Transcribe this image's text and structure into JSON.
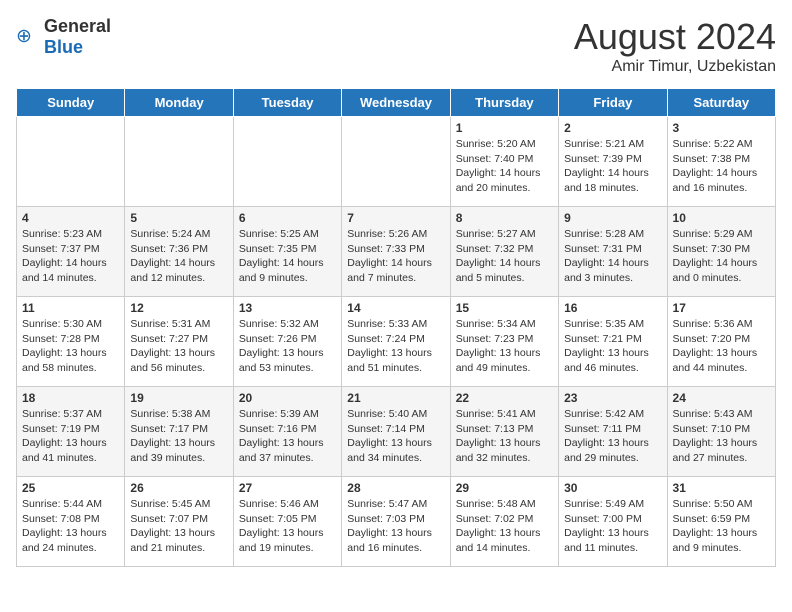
{
  "header": {
    "logo_general": "General",
    "logo_blue": "Blue",
    "title": "August 2024",
    "subtitle": "Amir Timur, Uzbekistan"
  },
  "days_of_week": [
    "Sunday",
    "Monday",
    "Tuesday",
    "Wednesday",
    "Thursday",
    "Friday",
    "Saturday"
  ],
  "weeks": [
    [
      {
        "day": "",
        "content": ""
      },
      {
        "day": "",
        "content": ""
      },
      {
        "day": "",
        "content": ""
      },
      {
        "day": "",
        "content": ""
      },
      {
        "day": "1",
        "content": "Sunrise: 5:20 AM\nSunset: 7:40 PM\nDaylight: 14 hours\nand 20 minutes."
      },
      {
        "day": "2",
        "content": "Sunrise: 5:21 AM\nSunset: 7:39 PM\nDaylight: 14 hours\nand 18 minutes."
      },
      {
        "day": "3",
        "content": "Sunrise: 5:22 AM\nSunset: 7:38 PM\nDaylight: 14 hours\nand 16 minutes."
      }
    ],
    [
      {
        "day": "4",
        "content": "Sunrise: 5:23 AM\nSunset: 7:37 PM\nDaylight: 14 hours\nand 14 minutes."
      },
      {
        "day": "5",
        "content": "Sunrise: 5:24 AM\nSunset: 7:36 PM\nDaylight: 14 hours\nand 12 minutes."
      },
      {
        "day": "6",
        "content": "Sunrise: 5:25 AM\nSunset: 7:35 PM\nDaylight: 14 hours\nand 9 minutes."
      },
      {
        "day": "7",
        "content": "Sunrise: 5:26 AM\nSunset: 7:33 PM\nDaylight: 14 hours\nand 7 minutes."
      },
      {
        "day": "8",
        "content": "Sunrise: 5:27 AM\nSunset: 7:32 PM\nDaylight: 14 hours\nand 5 minutes."
      },
      {
        "day": "9",
        "content": "Sunrise: 5:28 AM\nSunset: 7:31 PM\nDaylight: 14 hours\nand 3 minutes."
      },
      {
        "day": "10",
        "content": "Sunrise: 5:29 AM\nSunset: 7:30 PM\nDaylight: 14 hours\nand 0 minutes."
      }
    ],
    [
      {
        "day": "11",
        "content": "Sunrise: 5:30 AM\nSunset: 7:28 PM\nDaylight: 13 hours\nand 58 minutes."
      },
      {
        "day": "12",
        "content": "Sunrise: 5:31 AM\nSunset: 7:27 PM\nDaylight: 13 hours\nand 56 minutes."
      },
      {
        "day": "13",
        "content": "Sunrise: 5:32 AM\nSunset: 7:26 PM\nDaylight: 13 hours\nand 53 minutes."
      },
      {
        "day": "14",
        "content": "Sunrise: 5:33 AM\nSunset: 7:24 PM\nDaylight: 13 hours\nand 51 minutes."
      },
      {
        "day": "15",
        "content": "Sunrise: 5:34 AM\nSunset: 7:23 PM\nDaylight: 13 hours\nand 49 minutes."
      },
      {
        "day": "16",
        "content": "Sunrise: 5:35 AM\nSunset: 7:21 PM\nDaylight: 13 hours\nand 46 minutes."
      },
      {
        "day": "17",
        "content": "Sunrise: 5:36 AM\nSunset: 7:20 PM\nDaylight: 13 hours\nand 44 minutes."
      }
    ],
    [
      {
        "day": "18",
        "content": "Sunrise: 5:37 AM\nSunset: 7:19 PM\nDaylight: 13 hours\nand 41 minutes."
      },
      {
        "day": "19",
        "content": "Sunrise: 5:38 AM\nSunset: 7:17 PM\nDaylight: 13 hours\nand 39 minutes."
      },
      {
        "day": "20",
        "content": "Sunrise: 5:39 AM\nSunset: 7:16 PM\nDaylight: 13 hours\nand 37 minutes."
      },
      {
        "day": "21",
        "content": "Sunrise: 5:40 AM\nSunset: 7:14 PM\nDaylight: 13 hours\nand 34 minutes."
      },
      {
        "day": "22",
        "content": "Sunrise: 5:41 AM\nSunset: 7:13 PM\nDaylight: 13 hours\nand 32 minutes."
      },
      {
        "day": "23",
        "content": "Sunrise: 5:42 AM\nSunset: 7:11 PM\nDaylight: 13 hours\nand 29 minutes."
      },
      {
        "day": "24",
        "content": "Sunrise: 5:43 AM\nSunset: 7:10 PM\nDaylight: 13 hours\nand 27 minutes."
      }
    ],
    [
      {
        "day": "25",
        "content": "Sunrise: 5:44 AM\nSunset: 7:08 PM\nDaylight: 13 hours\nand 24 minutes."
      },
      {
        "day": "26",
        "content": "Sunrise: 5:45 AM\nSunset: 7:07 PM\nDaylight: 13 hours\nand 21 minutes."
      },
      {
        "day": "27",
        "content": "Sunrise: 5:46 AM\nSunset: 7:05 PM\nDaylight: 13 hours\nand 19 minutes."
      },
      {
        "day": "28",
        "content": "Sunrise: 5:47 AM\nSunset: 7:03 PM\nDaylight: 13 hours\nand 16 minutes."
      },
      {
        "day": "29",
        "content": "Sunrise: 5:48 AM\nSunset: 7:02 PM\nDaylight: 13 hours\nand 14 minutes."
      },
      {
        "day": "30",
        "content": "Sunrise: 5:49 AM\nSunset: 7:00 PM\nDaylight: 13 hours\nand 11 minutes."
      },
      {
        "day": "31",
        "content": "Sunrise: 5:50 AM\nSunset: 6:59 PM\nDaylight: 13 hours\nand 9 minutes."
      }
    ]
  ]
}
